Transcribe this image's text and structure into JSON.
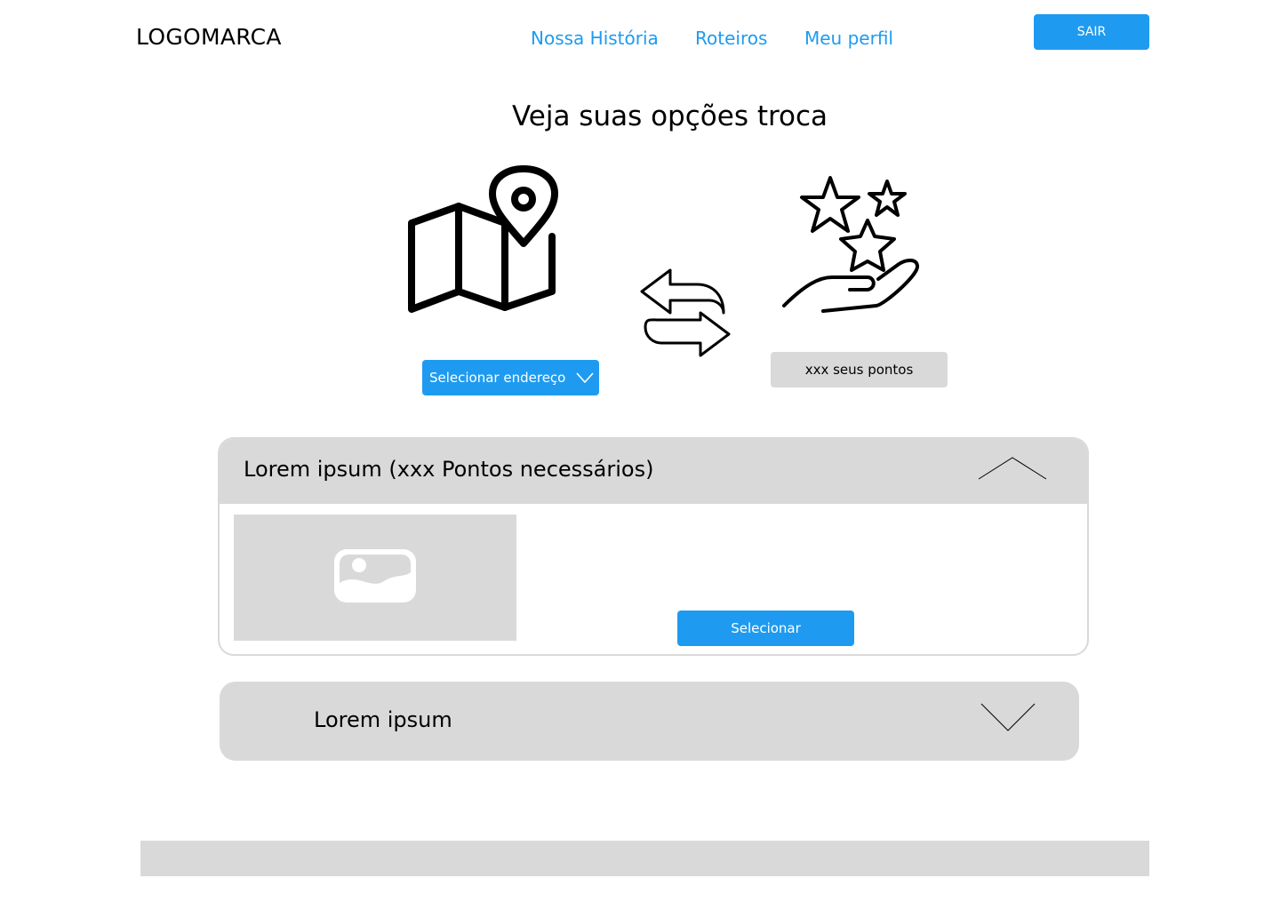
{
  "header": {
    "logo": "LOGOMARCA",
    "nav": [
      "Nossa História",
      "Roteiros",
      "Meu perfil"
    ],
    "logout_label": "SAIR"
  },
  "main": {
    "title": "Veja suas opções troca",
    "address_select": {
      "label": "Selecionar endereço",
      "icon": "chevron-down-icon"
    },
    "points_label": "xxx seus pontos",
    "icons": [
      "map-pin-icon",
      "swap-arrows-icon",
      "hand-stars-icon"
    ]
  },
  "cards": [
    {
      "title": "Lorem ipsum (xxx Pontos necessários)",
      "expanded": true,
      "select_label": "Selecionar",
      "icon": "chevron-up-icon"
    },
    {
      "title": "Lorem ipsum",
      "expanded": false,
      "icon": "chevron-down-icon"
    }
  ],
  "colors": {
    "accent": "#1e9bf0",
    "panel": "#d9d9d9"
  }
}
